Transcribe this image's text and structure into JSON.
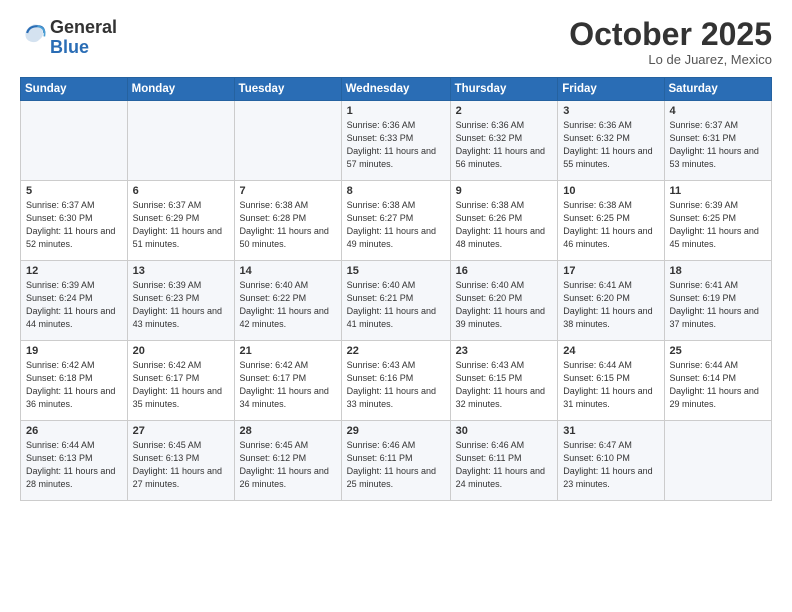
{
  "header": {
    "logo_general": "General",
    "logo_blue": "Blue",
    "month_title": "October 2025",
    "location": "Lo de Juarez, Mexico"
  },
  "days_of_week": [
    "Sunday",
    "Monday",
    "Tuesday",
    "Wednesday",
    "Thursday",
    "Friday",
    "Saturday"
  ],
  "weeks": [
    [
      {
        "day": "",
        "sunrise": "",
        "sunset": "",
        "daylight": ""
      },
      {
        "day": "",
        "sunrise": "",
        "sunset": "",
        "daylight": ""
      },
      {
        "day": "",
        "sunrise": "",
        "sunset": "",
        "daylight": ""
      },
      {
        "day": "1",
        "sunrise": "Sunrise: 6:36 AM",
        "sunset": "Sunset: 6:33 PM",
        "daylight": "Daylight: 11 hours and 57 minutes."
      },
      {
        "day": "2",
        "sunrise": "Sunrise: 6:36 AM",
        "sunset": "Sunset: 6:32 PM",
        "daylight": "Daylight: 11 hours and 56 minutes."
      },
      {
        "day": "3",
        "sunrise": "Sunrise: 6:36 AM",
        "sunset": "Sunset: 6:32 PM",
        "daylight": "Daylight: 11 hours and 55 minutes."
      },
      {
        "day": "4",
        "sunrise": "Sunrise: 6:37 AM",
        "sunset": "Sunset: 6:31 PM",
        "daylight": "Daylight: 11 hours and 53 minutes."
      }
    ],
    [
      {
        "day": "5",
        "sunrise": "Sunrise: 6:37 AM",
        "sunset": "Sunset: 6:30 PM",
        "daylight": "Daylight: 11 hours and 52 minutes."
      },
      {
        "day": "6",
        "sunrise": "Sunrise: 6:37 AM",
        "sunset": "Sunset: 6:29 PM",
        "daylight": "Daylight: 11 hours and 51 minutes."
      },
      {
        "day": "7",
        "sunrise": "Sunrise: 6:38 AM",
        "sunset": "Sunset: 6:28 PM",
        "daylight": "Daylight: 11 hours and 50 minutes."
      },
      {
        "day": "8",
        "sunrise": "Sunrise: 6:38 AM",
        "sunset": "Sunset: 6:27 PM",
        "daylight": "Daylight: 11 hours and 49 minutes."
      },
      {
        "day": "9",
        "sunrise": "Sunrise: 6:38 AM",
        "sunset": "Sunset: 6:26 PM",
        "daylight": "Daylight: 11 hours and 48 minutes."
      },
      {
        "day": "10",
        "sunrise": "Sunrise: 6:38 AM",
        "sunset": "Sunset: 6:25 PM",
        "daylight": "Daylight: 11 hours and 46 minutes."
      },
      {
        "day": "11",
        "sunrise": "Sunrise: 6:39 AM",
        "sunset": "Sunset: 6:25 PM",
        "daylight": "Daylight: 11 hours and 45 minutes."
      }
    ],
    [
      {
        "day": "12",
        "sunrise": "Sunrise: 6:39 AM",
        "sunset": "Sunset: 6:24 PM",
        "daylight": "Daylight: 11 hours and 44 minutes."
      },
      {
        "day": "13",
        "sunrise": "Sunrise: 6:39 AM",
        "sunset": "Sunset: 6:23 PM",
        "daylight": "Daylight: 11 hours and 43 minutes."
      },
      {
        "day": "14",
        "sunrise": "Sunrise: 6:40 AM",
        "sunset": "Sunset: 6:22 PM",
        "daylight": "Daylight: 11 hours and 42 minutes."
      },
      {
        "day": "15",
        "sunrise": "Sunrise: 6:40 AM",
        "sunset": "Sunset: 6:21 PM",
        "daylight": "Daylight: 11 hours and 41 minutes."
      },
      {
        "day": "16",
        "sunrise": "Sunrise: 6:40 AM",
        "sunset": "Sunset: 6:20 PM",
        "daylight": "Daylight: 11 hours and 39 minutes."
      },
      {
        "day": "17",
        "sunrise": "Sunrise: 6:41 AM",
        "sunset": "Sunset: 6:20 PM",
        "daylight": "Daylight: 11 hours and 38 minutes."
      },
      {
        "day": "18",
        "sunrise": "Sunrise: 6:41 AM",
        "sunset": "Sunset: 6:19 PM",
        "daylight": "Daylight: 11 hours and 37 minutes."
      }
    ],
    [
      {
        "day": "19",
        "sunrise": "Sunrise: 6:42 AM",
        "sunset": "Sunset: 6:18 PM",
        "daylight": "Daylight: 11 hours and 36 minutes."
      },
      {
        "day": "20",
        "sunrise": "Sunrise: 6:42 AM",
        "sunset": "Sunset: 6:17 PM",
        "daylight": "Daylight: 11 hours and 35 minutes."
      },
      {
        "day": "21",
        "sunrise": "Sunrise: 6:42 AM",
        "sunset": "Sunset: 6:17 PM",
        "daylight": "Daylight: 11 hours and 34 minutes."
      },
      {
        "day": "22",
        "sunrise": "Sunrise: 6:43 AM",
        "sunset": "Sunset: 6:16 PM",
        "daylight": "Daylight: 11 hours and 33 minutes."
      },
      {
        "day": "23",
        "sunrise": "Sunrise: 6:43 AM",
        "sunset": "Sunset: 6:15 PM",
        "daylight": "Daylight: 11 hours and 32 minutes."
      },
      {
        "day": "24",
        "sunrise": "Sunrise: 6:44 AM",
        "sunset": "Sunset: 6:15 PM",
        "daylight": "Daylight: 11 hours and 31 minutes."
      },
      {
        "day": "25",
        "sunrise": "Sunrise: 6:44 AM",
        "sunset": "Sunset: 6:14 PM",
        "daylight": "Daylight: 11 hours and 29 minutes."
      }
    ],
    [
      {
        "day": "26",
        "sunrise": "Sunrise: 6:44 AM",
        "sunset": "Sunset: 6:13 PM",
        "daylight": "Daylight: 11 hours and 28 minutes."
      },
      {
        "day": "27",
        "sunrise": "Sunrise: 6:45 AM",
        "sunset": "Sunset: 6:13 PM",
        "daylight": "Daylight: 11 hours and 27 minutes."
      },
      {
        "day": "28",
        "sunrise": "Sunrise: 6:45 AM",
        "sunset": "Sunset: 6:12 PM",
        "daylight": "Daylight: 11 hours and 26 minutes."
      },
      {
        "day": "29",
        "sunrise": "Sunrise: 6:46 AM",
        "sunset": "Sunset: 6:11 PM",
        "daylight": "Daylight: 11 hours and 25 minutes."
      },
      {
        "day": "30",
        "sunrise": "Sunrise: 6:46 AM",
        "sunset": "Sunset: 6:11 PM",
        "daylight": "Daylight: 11 hours and 24 minutes."
      },
      {
        "day": "31",
        "sunrise": "Sunrise: 6:47 AM",
        "sunset": "Sunset: 6:10 PM",
        "daylight": "Daylight: 11 hours and 23 minutes."
      },
      {
        "day": "",
        "sunrise": "",
        "sunset": "",
        "daylight": ""
      }
    ]
  ]
}
